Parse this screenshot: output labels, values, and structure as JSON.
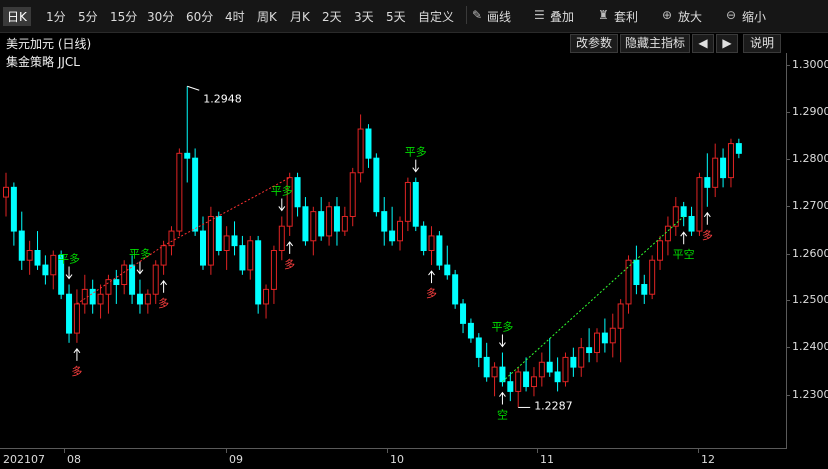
{
  "toolbar": {
    "periods": [
      "日K",
      "1分",
      "5分",
      "15分",
      "30分",
      "60分",
      "4时",
      "周K",
      "月K",
      "2天",
      "3天",
      "5天",
      "自定义"
    ],
    "active_period": "日K",
    "tools": [
      {
        "icon": "pencil-icon",
        "label": "画线"
      },
      {
        "icon": "layers-icon",
        "label": "叠加"
      },
      {
        "icon": "bag-icon",
        "label": "套利"
      },
      {
        "icon": "zoom-in-icon",
        "label": "放大"
      },
      {
        "icon": "zoom-out-icon",
        "label": "缩小"
      }
    ]
  },
  "info": {
    "title": "美元加元 (日线)",
    "indicator": "集金策略 JJCL",
    "buttons": {
      "params": "改参数",
      "hide": "隐藏主指标",
      "prev": "◀",
      "next": "▶",
      "help": "说明"
    }
  },
  "y_axis": {
    "ticks": [
      "1.3000",
      "1.2900",
      "1.2800",
      "1.2700",
      "1.2600",
      "1.2500",
      "1.2400",
      "1.2300"
    ]
  },
  "x_axis": {
    "ticks": [
      "202107",
      "08",
      "09",
      "10",
      "11",
      "12"
    ]
  },
  "colors": {
    "up": "#e02424",
    "down": "#00ffff",
    "long_signal": "#ff4040",
    "flat_signal": "#00dd00",
    "bg": "#000000"
  },
  "annotations": {
    "high": "1.2948",
    "low": "1.2287"
  },
  "chart_data": {
    "type": "candlestick",
    "y_range": [
      1.222,
      1.3
    ],
    "candles": [
      [
        1.272,
        1.277,
        1.268,
        1.274
      ],
      [
        1.274,
        1.275,
        1.262,
        1.265
      ],
      [
        1.265,
        1.269,
        1.257,
        1.259
      ],
      [
        1.259,
        1.263,
        1.256,
        1.261
      ],
      [
        1.261,
        1.265,
        1.257,
        1.258
      ],
      [
        1.258,
        1.26,
        1.254,
        1.256
      ],
      [
        1.256,
        1.261,
        1.253,
        1.26
      ],
      [
        1.26,
        1.261,
        1.251,
        1.252
      ],
      [
        1.252,
        1.254,
        1.242,
        1.244
      ],
      [
        1.244,
        1.253,
        1.242,
        1.25
      ],
      [
        1.25,
        1.256,
        1.248,
        1.253
      ],
      [
        1.253,
        1.255,
        1.248,
        1.25
      ],
      [
        1.25,
        1.254,
        1.247,
        1.252
      ],
      [
        1.252,
        1.256,
        1.248,
        1.255
      ],
      [
        1.255,
        1.257,
        1.25,
        1.254
      ],
      [
        1.254,
        1.259,
        1.252,
        1.258
      ],
      [
        1.258,
        1.26,
        1.25,
        1.252
      ],
      [
        1.252,
        1.255,
        1.248,
        1.25
      ],
      [
        1.25,
        1.253,
        1.248,
        1.252
      ],
      [
        1.252,
        1.259,
        1.25,
        1.258
      ],
      [
        1.258,
        1.263,
        1.256,
        1.262
      ],
      [
        1.262,
        1.266,
        1.26,
        1.265
      ],
      [
        1.265,
        1.282,
        1.264,
        1.281
      ],
      [
        1.281,
        1.2948,
        1.275,
        1.28
      ],
      [
        1.28,
        1.282,
        1.264,
        1.265
      ],
      [
        1.265,
        1.268,
        1.257,
        1.258
      ],
      [
        1.258,
        1.27,
        1.256,
        1.268
      ],
      [
        1.268,
        1.269,
        1.26,
        1.261
      ],
      [
        1.261,
        1.266,
        1.257,
        1.264
      ],
      [
        1.264,
        1.267,
        1.26,
        1.262
      ],
      [
        1.262,
        1.264,
        1.256,
        1.257
      ],
      [
        1.257,
        1.264,
        1.255,
        1.263
      ],
      [
        1.263,
        1.264,
        1.248,
        1.25
      ],
      [
        1.25,
        1.254,
        1.247,
        1.253
      ],
      [
        1.253,
        1.262,
        1.25,
        1.261
      ],
      [
        1.261,
        1.268,
        1.259,
        1.266
      ],
      [
        1.266,
        1.277,
        1.264,
        1.276
      ],
      [
        1.276,
        1.277,
        1.268,
        1.27
      ],
      [
        1.27,
        1.272,
        1.262,
        1.263
      ],
      [
        1.263,
        1.27,
        1.26,
        1.269
      ],
      [
        1.269,
        1.272,
        1.263,
        1.264
      ],
      [
        1.264,
        1.271,
        1.262,
        1.27
      ],
      [
        1.27,
        1.272,
        1.262,
        1.265
      ],
      [
        1.265,
        1.27,
        1.264,
        1.268
      ],
      [
        1.268,
        1.278,
        1.266,
        1.277
      ],
      [
        1.277,
        1.289,
        1.275,
        1.286
      ],
      [
        1.286,
        1.287,
        1.278,
        1.28
      ],
      [
        1.28,
        1.281,
        1.268,
        1.269
      ],
      [
        1.269,
        1.272,
        1.262,
        1.265
      ],
      [
        1.265,
        1.27,
        1.262,
        1.263
      ],
      [
        1.263,
        1.268,
        1.261,
        1.267
      ],
      [
        1.267,
        1.276,
        1.265,
        1.275
      ],
      [
        1.275,
        1.276,
        1.265,
        1.266
      ],
      [
        1.266,
        1.267,
        1.26,
        1.261
      ],
      [
        1.261,
        1.266,
        1.258,
        1.264
      ],
      [
        1.264,
        1.265,
        1.257,
        1.258
      ],
      [
        1.258,
        1.262,
        1.255,
        1.256
      ],
      [
        1.256,
        1.257,
        1.249,
        1.25
      ],
      [
        1.25,
        1.251,
        1.244,
        1.246
      ],
      [
        1.246,
        1.247,
        1.242,
        1.243
      ],
      [
        1.243,
        1.244,
        1.237,
        1.239
      ],
      [
        1.239,
        1.242,
        1.234,
        1.235
      ],
      [
        1.235,
        1.238,
        1.231,
        1.237
      ],
      [
        1.237,
        1.24,
        1.233,
        1.234
      ],
      [
        1.234,
        1.236,
        1.23,
        1.232
      ],
      [
        1.232,
        1.237,
        1.2287,
        1.236
      ],
      [
        1.236,
        1.239,
        1.232,
        1.233
      ],
      [
        1.233,
        1.237,
        1.231,
        1.235
      ],
      [
        1.235,
        1.24,
        1.233,
        1.238
      ],
      [
        1.238,
        1.243,
        1.235,
        1.236
      ],
      [
        1.236,
        1.239,
        1.232,
        1.234
      ],
      [
        1.234,
        1.24,
        1.233,
        1.239
      ],
      [
        1.239,
        1.241,
        1.235,
        1.237
      ],
      [
        1.237,
        1.243,
        1.235,
        1.241
      ],
      [
        1.241,
        1.245,
        1.238,
        1.24
      ],
      [
        1.24,
        1.245,
        1.238,
        1.244
      ],
      [
        1.244,
        1.247,
        1.24,
        1.242
      ],
      [
        1.242,
        1.248,
        1.239,
        1.245
      ],
      [
        1.245,
        1.251,
        1.238,
        1.25
      ],
      [
        1.25,
        1.26,
        1.248,
        1.259
      ],
      [
        1.259,
        1.262,
        1.252,
        1.254
      ],
      [
        1.254,
        1.256,
        1.25,
        1.252
      ],
      [
        1.252,
        1.26,
        1.251,
        1.259
      ],
      [
        1.259,
        1.264,
        1.257,
        1.263
      ],
      [
        1.263,
        1.268,
        1.26,
        1.266
      ],
      [
        1.266,
        1.272,
        1.264,
        1.27
      ],
      [
        1.27,
        1.271,
        1.266,
        1.268
      ],
      [
        1.268,
        1.27,
        1.264,
        1.265
      ],
      [
        1.265,
        1.277,
        1.264,
        1.276
      ],
      [
        1.276,
        1.281,
        1.27,
        1.274
      ],
      [
        1.274,
        1.283,
        1.272,
        1.28
      ],
      [
        1.28,
        1.282,
        1.274,
        1.276
      ],
      [
        1.276,
        1.284,
        1.274,
        1.283
      ],
      [
        1.283,
        1.284,
        1.28,
        1.281
      ]
    ],
    "markers": [
      {
        "type": "up",
        "index": 9,
        "label": "多"
      },
      {
        "type": "down",
        "index": 8,
        "label": "平多"
      },
      {
        "type": "down",
        "index": 17,
        "label": "平多"
      },
      {
        "type": "up",
        "index": 20,
        "label": "多"
      },
      {
        "type": "down",
        "index": 35,
        "label": "平多"
      },
      {
        "type": "up",
        "index": 36,
        "label": "多"
      },
      {
        "type": "down",
        "index": 52,
        "label": "平多"
      },
      {
        "type": "up",
        "index": 54,
        "label": "多"
      },
      {
        "type": "down",
        "index": 63,
        "label": "平多"
      },
      {
        "type": "up",
        "index": 63,
        "label": "空"
      },
      {
        "type": "up",
        "index": 86,
        "label": "平空"
      },
      {
        "type": "up",
        "index": 89,
        "label": "多"
      }
    ]
  }
}
